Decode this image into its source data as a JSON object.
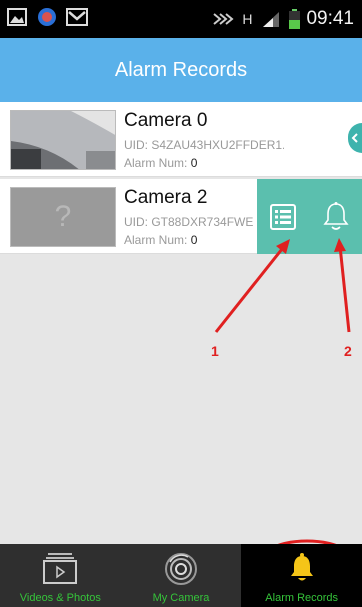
{
  "status_bar": {
    "time": "09:41",
    "icons": [
      "gallery-icon",
      "app-icon",
      "mail-icon",
      "nfc-icon",
      "hspa-icon",
      "signal-icon",
      "battery-icon"
    ],
    "network_label": "H"
  },
  "header": {
    "title": "Alarm Records"
  },
  "cameras": [
    {
      "name": "Camera 0",
      "uid": "UID: S4ZAU43HXU2FFDER1...",
      "alarm_label": "Alarm Num:",
      "alarm_num": "0"
    },
    {
      "name": "Camera 2",
      "uid": "UID: GT88DXR734FWE",
      "alarm_label": "Alarm Num:",
      "alarm_num": "0"
    }
  ],
  "actions": {
    "records_icon": "list-icon",
    "bell_icon": "bell-icon"
  },
  "annotations": [
    {
      "label": "1"
    },
    {
      "label": "2"
    }
  ],
  "tabs": [
    {
      "label": "Videos & Photos",
      "icon": "videos-photos-icon"
    },
    {
      "label": "My Camera",
      "icon": "camera-lens-icon"
    },
    {
      "label": "Alarm Records",
      "icon": "bell-icon",
      "active": true
    }
  ],
  "colors": {
    "header": "#5ab1ea",
    "action_panel": "#5bbfae",
    "tab_text": "#35c43a",
    "annotation": "#e02020"
  }
}
